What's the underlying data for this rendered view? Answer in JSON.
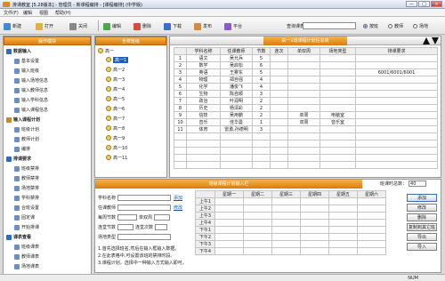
{
  "window": {
    "title": "排课教室 [5.28版本] - 管理员 - 新课程编排 - [课程编排] (中学版)",
    "min": "—",
    "max": "□",
    "close": "×"
  },
  "menu": [
    "文件(F)",
    "编辑",
    "视图",
    "帮助(H)"
  ],
  "toolbar": [
    "新建",
    "打开",
    "关闭",
    "编辑",
    "删除",
    "下载",
    "发布",
    "平台"
  ],
  "search": {
    "label": "查询课表",
    "value": ""
  },
  "radios": [
    {
      "label": "按班",
      "on": true
    },
    {
      "label": "教师",
      "on": false
    },
    {
      "label": "场地",
      "on": false
    }
  ],
  "left": {
    "header": "操作模块",
    "items": [
      {
        "label": "数据输入",
        "group": true,
        "color": "#2d6bc7"
      },
      {
        "label": "基本设置",
        "group": false,
        "color": "#6a8fc9"
      },
      {
        "label": "输入班级",
        "group": false,
        "color": "#6a8fc9"
      },
      {
        "label": "输入场地信息",
        "group": false,
        "color": "#6a8fc9"
      },
      {
        "label": "输入教师信息",
        "group": false,
        "color": "#6a8fc9"
      },
      {
        "label": "输入学科信息",
        "group": false,
        "color": "#6a8fc9"
      },
      {
        "label": "输入课程信息",
        "group": false,
        "color": "#6a8fc9"
      },
      {
        "label": "输入课程计划",
        "group": true,
        "color": "#c78a2d"
      },
      {
        "label": "班级计划",
        "group": false,
        "color": "#6a8fc9"
      },
      {
        "label": "教师计划",
        "group": false,
        "color": "#6a8fc9"
      },
      {
        "label": "编排",
        "group": false,
        "color": "#6a8fc9"
      },
      {
        "label": "排课要求",
        "group": true,
        "color": "#2d6bc7"
      },
      {
        "label": "班级禁排",
        "group": false,
        "color": "#6a8fc9"
      },
      {
        "label": "教师禁排",
        "group": false,
        "color": "#6a8fc9"
      },
      {
        "label": "场地禁排",
        "group": false,
        "color": "#6a8fc9"
      },
      {
        "label": "学科禁排",
        "group": false,
        "color": "#6a8fc9"
      },
      {
        "label": "合班设置",
        "group": false,
        "color": "#6a8fc9"
      },
      {
        "label": "固定课",
        "group": false,
        "color": "#6a8fc9"
      },
      {
        "label": "开始排课",
        "group": false,
        "color": "#6a8fc9"
      },
      {
        "label": "课表查看",
        "group": true,
        "color": "#2d6bc7"
      },
      {
        "label": "班级课表",
        "group": false,
        "color": "#6a8fc9"
      },
      {
        "label": "教师课表",
        "group": false,
        "color": "#6a8fc9"
      },
      {
        "label": "场地课表",
        "group": false,
        "color": "#6a8fc9"
      }
    ]
  },
  "mid": {
    "header": "全校班级",
    "root": "高一",
    "classes": [
      "高一1",
      "高一2",
      "高一3",
      "高一4",
      "高一5",
      "高一6",
      "高一7",
      "高一8",
      "高一9",
      "高一10",
      "高一11"
    ],
    "selected": 0
  },
  "plan": {
    "header": "高一1班课程计划信息表",
    "columns": [
      "",
      "学科名称",
      "任课教师",
      "节数",
      "连次",
      "单双周",
      "场地类型",
      "排课要求"
    ],
    "rows": [
      [
        "1",
        "语文",
        "吴允兵",
        "5",
        "",
        "",
        "",
        ""
      ],
      [
        "2",
        "数学",
        "吴启松",
        "6",
        "",
        "",
        "",
        ""
      ],
      [
        "3",
        "英语",
        "王雾东",
        "5",
        "",
        "",
        "",
        "6001/6001/6001"
      ],
      [
        "4",
        "物理",
        "郑自强",
        "4",
        "",
        "",
        "",
        ""
      ],
      [
        "5",
        "化学",
        "潘俊飞",
        "4",
        "",
        "",
        "",
        ""
      ],
      [
        "6",
        "生物",
        "陈自顺",
        "3",
        "",
        "",
        "",
        ""
      ],
      [
        "7",
        "政治",
        "叶润明",
        "2",
        "",
        "",
        "",
        ""
      ],
      [
        "8",
        "历史",
        "杨清彩",
        "2",
        "",
        "",
        "",
        ""
      ],
      [
        "9",
        "信技",
        "吴用鹏",
        "2",
        "",
        "单周",
        "电脑室",
        ""
      ],
      [
        "10",
        "音乐",
        "佳华曼",
        "1",
        "",
        "双周",
        "音乐室",
        ""
      ],
      [
        "11",
        "体育",
        "雷勇,孙德明",
        "3",
        "",
        "",
        "",
        ""
      ]
    ]
  },
  "input": {
    "header": "班级课程计划输入栏",
    "hours_label": "班课时总数：",
    "hours_value": "40",
    "fields": [
      {
        "label": "学科名称",
        "value": ""
      },
      {
        "label": "任课教师",
        "value": ""
      },
      {
        "label": "每周节数",
        "value": "",
        "label2": "单双周",
        "value2": ""
      },
      {
        "label": "连堂节数",
        "value": "",
        "label2": "连堂次数",
        "value2": ""
      },
      {
        "label": "场地类型",
        "value": ""
      }
    ],
    "link1": "添加",
    "link2": "修改",
    "notes": [
      "1.首先选择班名,然后在输入框输入数据。",
      "2.在此表格中,可设置该班的禁排时段。",
      "3.课程计划，选择中一种输入方式输入即可。"
    ],
    "days": [
      "",
      "星期一",
      "星期二",
      "星期三",
      "星期四",
      "星期五",
      "星期六"
    ],
    "periods": [
      "上午1",
      "上午2",
      "上午3",
      "上午4",
      "下午1",
      "下午2",
      "下午3",
      "下午4"
    ],
    "buttons": [
      "添加",
      "修改",
      "删除",
      "复制到其它班",
      "导出",
      "导入"
    ]
  },
  "status": "NUM"
}
